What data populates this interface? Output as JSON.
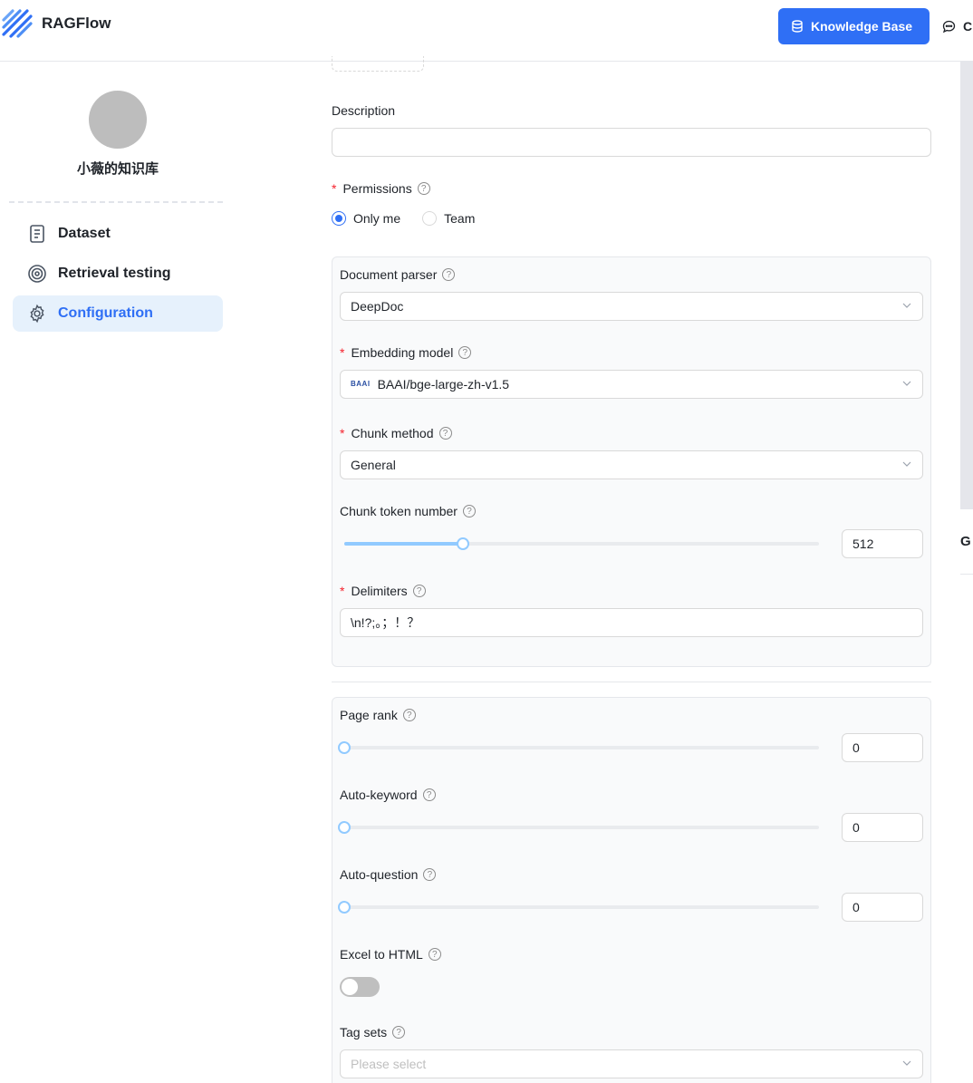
{
  "header": {
    "brand": "RAGFlow",
    "knowledge_base_label": "Knowledge Base",
    "chat_label_partial": "C"
  },
  "sidebar": {
    "kb_name": "小薇的知识库",
    "items": [
      {
        "label": "Dataset",
        "icon": "document-icon",
        "active": false
      },
      {
        "label": "Retrieval testing",
        "icon": "target-icon",
        "active": false
      },
      {
        "label": "Configuration",
        "icon": "gear-icon",
        "active": true
      }
    ]
  },
  "right_partial": {
    "text": "G"
  },
  "form": {
    "description": {
      "label": "Description",
      "value": ""
    },
    "permissions": {
      "label": "Permissions",
      "options": [
        "Only me",
        "Team"
      ],
      "selected": "Only me"
    },
    "document_parser": {
      "label": "Document parser",
      "value": "DeepDoc"
    },
    "embedding_model": {
      "label": "Embedding model",
      "value": "BAAI/bge-large-zh-v1.5",
      "logo_text": "BAAI"
    },
    "chunk_method": {
      "label": "Chunk method",
      "value": "General"
    },
    "chunk_token_number": {
      "label": "Chunk token number",
      "value": "512",
      "fraction": 0.25
    },
    "delimiters": {
      "label": "Delimiters",
      "value": "\\n!?;。；！？"
    },
    "page_rank": {
      "label": "Page rank",
      "value": "0",
      "fraction": 0
    },
    "auto_keyword": {
      "label": "Auto-keyword",
      "value": "0",
      "fraction": 0
    },
    "auto_question": {
      "label": "Auto-question",
      "value": "0",
      "fraction": 0
    },
    "excel_to_html": {
      "label": "Excel to HTML",
      "enabled": false
    },
    "tag_sets": {
      "label": "Tag sets",
      "placeholder": "Please select"
    }
  },
  "colors": {
    "primary": "#2f6ff5",
    "active_bg": "#e6f1fc",
    "required": "#f5222d",
    "slider": "#91caff"
  }
}
